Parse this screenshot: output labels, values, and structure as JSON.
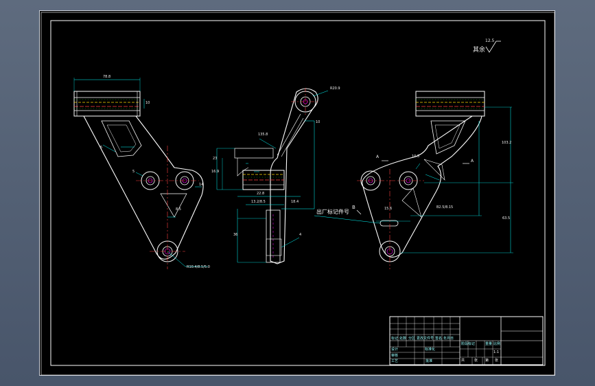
{
  "roughness": {
    "prefix": "其余",
    "value": "12.5"
  },
  "views": {
    "left": {
      "dims": {
        "top_width": "78.8",
        "flange": "10",
        "left_small": "5",
        "center": "5",
        "angle": "8.5",
        "right": "14",
        "bottom_label": "R10.4/8.5/5.0"
      }
    },
    "middle": {
      "dims": {
        "top_r": "R20.9",
        "slant": "135.8",
        "gap": "10",
        "height_a": "23",
        "height_b": "16.9",
        "width_a": "22.8",
        "width_b": "13.2/8.5",
        "width_c": "18.4",
        "tail": "36",
        "tail_right": "4"
      }
    },
    "right": {
      "section_label": "A",
      "section_right": "A",
      "side_label": "B",
      "dims": {
        "h1": "103.2",
        "h2": "63.5",
        "center": "10.5",
        "bore": "B2.5/8.15",
        "bottom": "15.6"
      },
      "leader_text": "出厂标记件号"
    }
  },
  "title_block": {
    "label_cells": [
      "标记",
      "处数",
      "分区",
      "更改文件号",
      "签名",
      "年月日"
    ],
    "approval_cells": [
      "设计",
      "标准化",
      "审核",
      "工艺",
      "批准"
    ],
    "info_cells": [
      "阶段标记",
      "重量",
      "比例"
    ],
    "scale": "1:1",
    "sheet_cells": [
      "共",
      "张",
      "第",
      "张"
    ]
  }
}
